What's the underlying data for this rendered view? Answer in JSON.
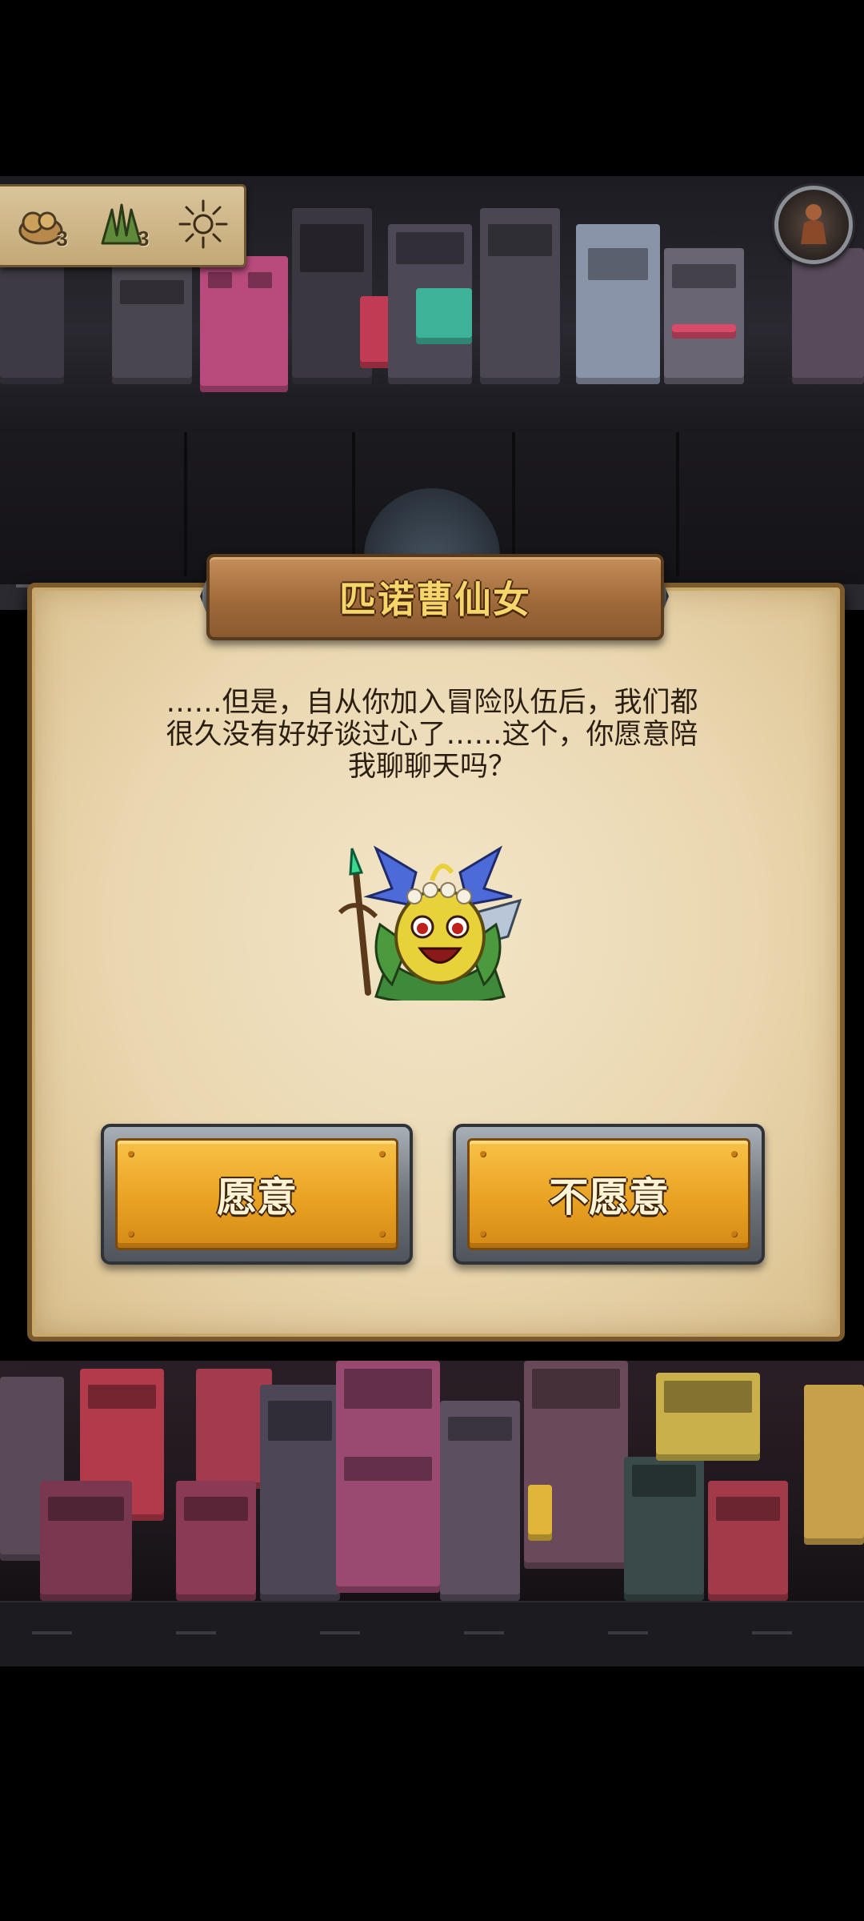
{
  "hud": {
    "resources": [
      {
        "icon": "gold-ore-icon",
        "count": "3"
      },
      {
        "icon": "herb-icon",
        "count": "3"
      },
      {
        "icon": "sun-icon",
        "count": ""
      }
    ],
    "avatar_icon": "hero-avatar-icon"
  },
  "dialog": {
    "title": "匹诺曹仙女",
    "message_lines": [
      "……但是，自从你加入冒险队伍后，我们都",
      "很久没有好好谈过心了……这个，你愿意陪",
      "我聊聊天吗？"
    ],
    "portrait_icon": "fairy-character-portrait",
    "accept_label": "愿意",
    "decline_label": "不愿意"
  },
  "colors": {
    "parchment": "#ead7b0",
    "button_gold": "#eaa223",
    "title_text": "#f6d66a"
  }
}
